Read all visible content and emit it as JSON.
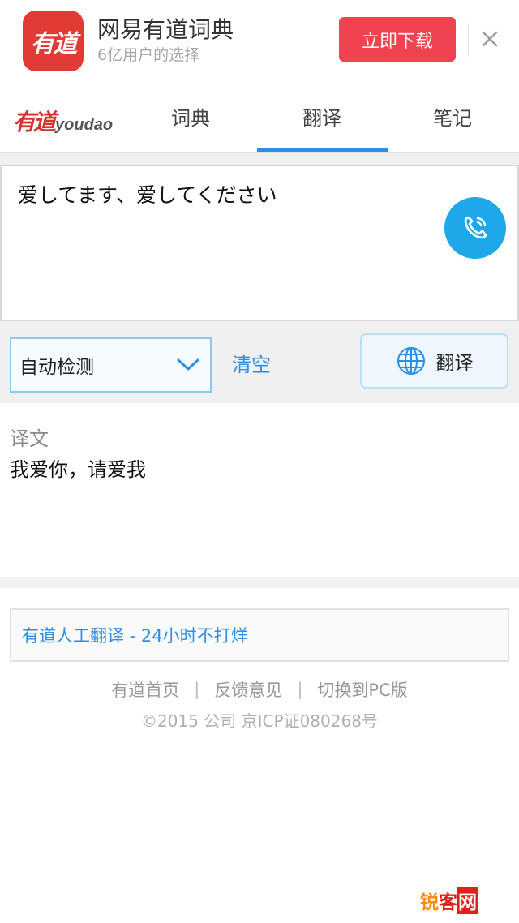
{
  "banner": {
    "logo_text": "有道",
    "app_name": "网易有道词典",
    "app_subtitle": "6亿用户的选择",
    "download_label": "立即下载",
    "close_icon": "close-icon"
  },
  "nav": {
    "brand_cn": "有道",
    "brand_en": "youdao",
    "tabs": [
      {
        "label": "词典"
      },
      {
        "label": "翻译"
      },
      {
        "label": "笔记"
      }
    ],
    "active_tab": "翻译",
    "accent_color": "#2d8ee5"
  },
  "input": {
    "value": "爱してます、爱してください",
    "voice_icon": "phone-icon"
  },
  "controls": {
    "language_selected": "自动检测",
    "clear_label": "清空",
    "translate_label": "翻译",
    "translate_icon": "globe-icon"
  },
  "result": {
    "label": "译文",
    "text": "我爱你，请爱我"
  },
  "human_translation": {
    "label": "有道人工翻译 - 24小时不打烊"
  },
  "footer": {
    "links": [
      {
        "label": "有道首页"
      },
      {
        "label": "反馈意见"
      },
      {
        "label": "切换到PC版"
      }
    ],
    "separator": "|",
    "copyright": "©2015 公司 京ICP证080268号"
  },
  "watermark": {
    "part1": "锐",
    "part2": "客",
    "part3": "网"
  }
}
